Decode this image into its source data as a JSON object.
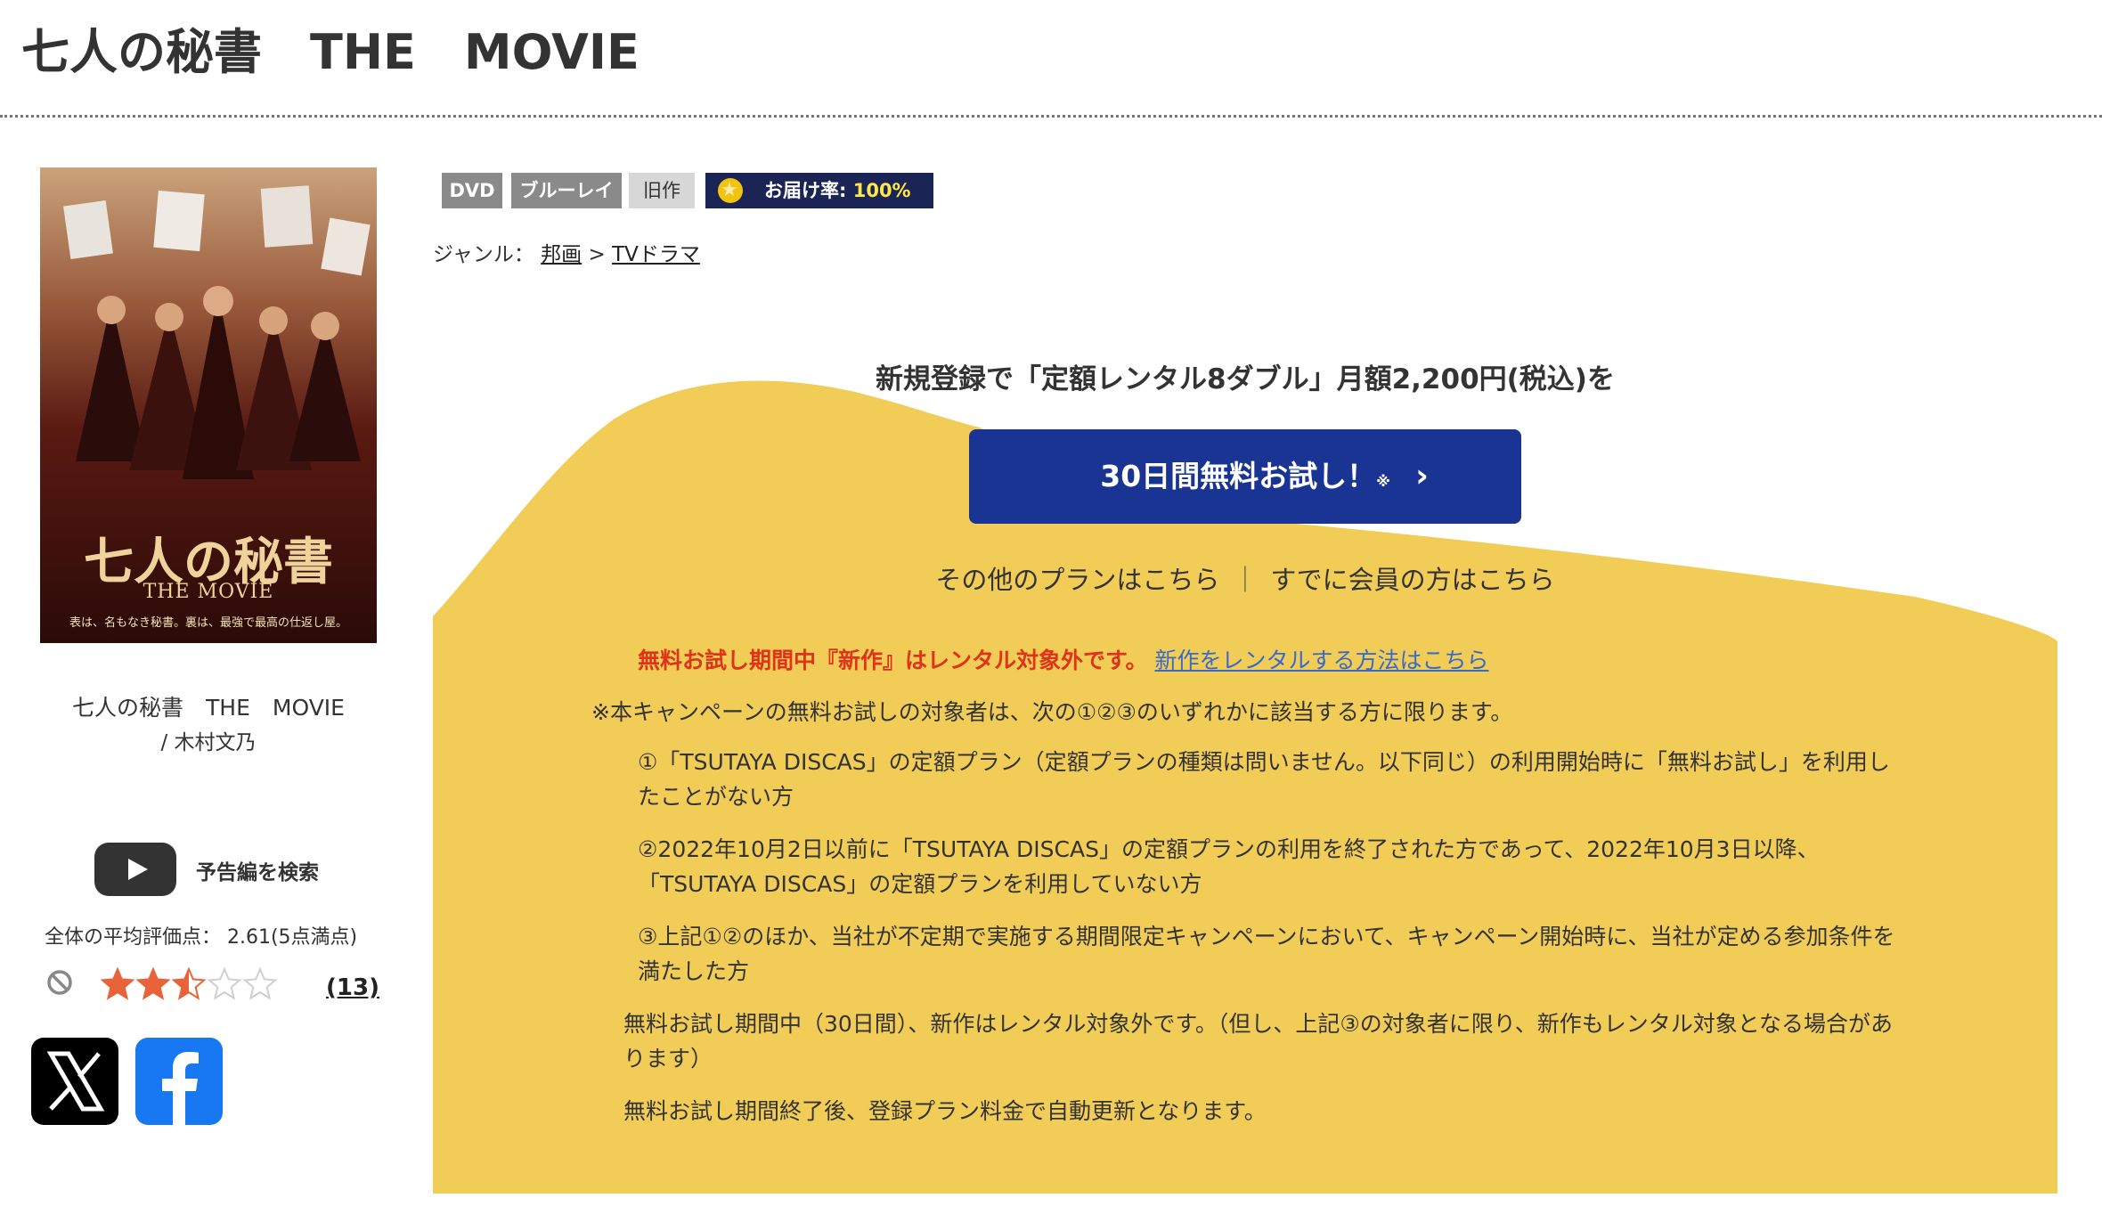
{
  "page": {
    "title": "七人の秘書　THE　MOVIE"
  },
  "poster": {
    "title": "七人の秘書",
    "subtitle": "THE MOVIE",
    "tagline": "表は、名もなき秘書。裏は、最強で最高の仕返し屋。",
    "format": "DVD"
  },
  "left": {
    "movie_title": "七人の秘書　THE　MOVIE",
    "author": "/ 木村文乃",
    "trailer_label": "予告編を検索",
    "rating_text": "全体の平均評価点： 2.61(5点満点)",
    "rating_value": 2.61,
    "rating_max": 5,
    "review_count": "(13)",
    "social": [
      "x-icon",
      "facebook-icon"
    ]
  },
  "badges": {
    "dvd": "DVD",
    "bluray": "ブルーレイ",
    "old": "旧作",
    "delivery_label": "お届け率: ",
    "delivery_pct": "100%"
  },
  "genre": {
    "label": "ジャンル：",
    "cat1": "邦画",
    "sep": ">",
    "cat2": "TVドラマ"
  },
  "promo": {
    "headline": "新規登録で「定額レンタル8ダブル」月額2,200円(税込)を",
    "cta_label": "30日間無料お試し！",
    "cta_mark": "※",
    "cta_chevron": "›",
    "other_plans": "その他のプランはこちら",
    "link_sep": "｜",
    "member_login": "すでに会員の方はこちら",
    "warning": "無料お試し期間中『新作』はレンタル対象外です。",
    "warning_link": "新作をレンタルする方法はこちら",
    "note": "※本キャンペーンの無料お試しの対象者は、次の①②③のいずれかに該当する方に限ります。",
    "item1": "①「TSUTAYA DISCAS」の定額プラン（定額プランの種類は問いません。以下同じ）の利用開始時に「無料お試し」を利用したことがない方",
    "item2": "②2022年10月2日以前に「TSUTAYA DISCAS」の定額プランの利用を終了された方であって、2022年10月3日以降、「TSUTAYA DISCAS」の定額プランを利用していない方",
    "item3": "③上記①②のほか、当社が不定期で実施する期間限定キャンペーンにおいて、キャンペーン開始時に、当社が定める参加条件を満たした方",
    "para1": "無料お試し期間中（30日間）、新作はレンタル対象外です。（但し、上記③の対象者に限り、新作もレンタル対象となる場合があります）",
    "para2": "無料お試し期間終了後、登録プラン料金で自動更新となります。"
  },
  "colors": {
    "accent": "#1a3494",
    "promo_bg": "#f1cd58",
    "warning": "#e0331b",
    "link": "#3a6ac8",
    "badge_navy": "#1a2555",
    "star": "#e8633a"
  }
}
